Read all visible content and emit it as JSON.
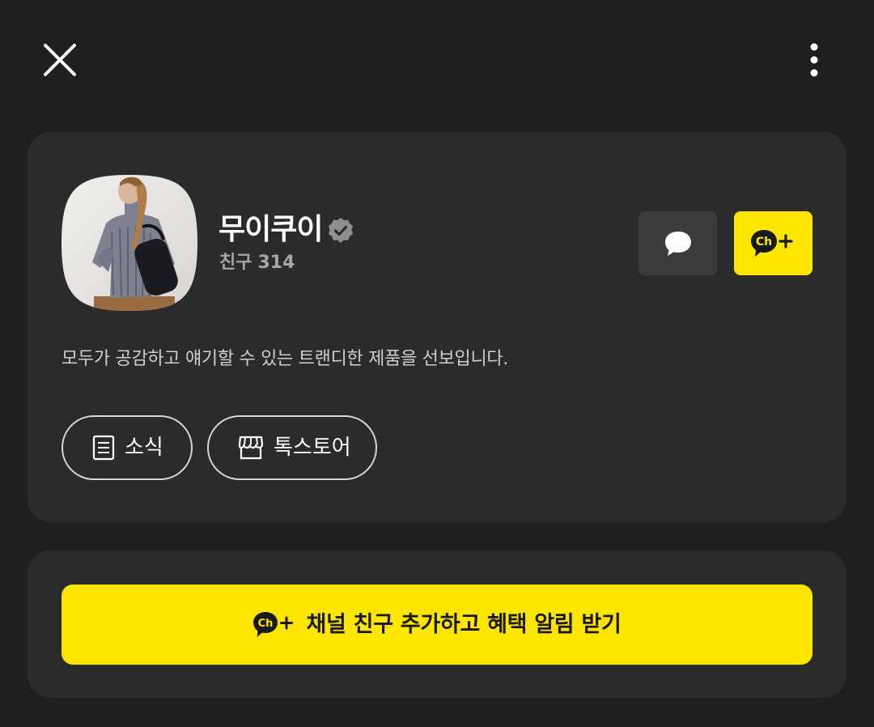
{
  "header": {
    "close_icon": "close-icon",
    "more_icon": "more-vertical-icon"
  },
  "profile": {
    "name": "무이쿠이",
    "verified_icon": "verified-badge-icon",
    "friends_label": "친구",
    "friends_count": "314",
    "description": "모두가 공감하고 얘기할 수 있는 트랜디한 제품을 선보입니다."
  },
  "actions": {
    "chat_icon": "chat-bubble-icon",
    "channel_add_icon": "channel-add-icon"
  },
  "links": {
    "news_label": "소식",
    "news_icon": "document-icon",
    "store_label": "톡스토어",
    "store_icon": "store-icon"
  },
  "cta": {
    "label": "채널 친구 추가하고 혜택 알림 받기",
    "icon": "channel-add-icon"
  },
  "colors": {
    "background": "#1f1f1f",
    "card": "#2b2b2b",
    "accent_yellow": "#fee500",
    "chat_button": "#3c3c3c"
  }
}
